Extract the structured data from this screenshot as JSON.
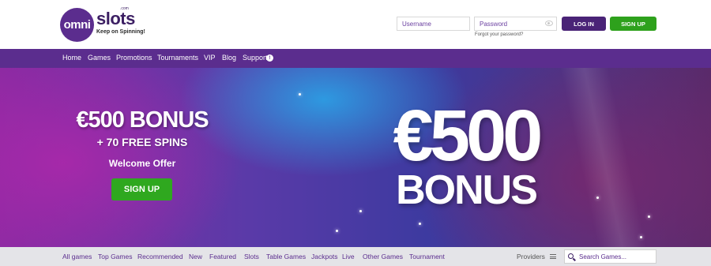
{
  "header": {
    "logo_left": "omni",
    "logo_right": "slots",
    "logo_com": ".com",
    "tagline": "Keep on Spinning!",
    "username_placeholder": "Username",
    "password_placeholder": "Password",
    "forgot": "Forgot your password?",
    "login_label": "LOG IN",
    "signup_label": "SIGN UP"
  },
  "nav": {
    "items": [
      "Home",
      "Games",
      "Promotions",
      "Tournaments",
      "VIP",
      "Blog",
      "Support"
    ],
    "support_badge": "!"
  },
  "hero": {
    "bonus_title": "€500 BONUS",
    "bonus_sub": "+ 70 FREE SPINS",
    "welcome": "Welcome Offer",
    "signup_label": "SIGN UP",
    "big_amount": "€500",
    "big_bonus": "BONUS"
  },
  "categories": {
    "items": [
      "All games",
      "Top Games",
      "Recommended",
      "New",
      "Featured",
      "Slots",
      "Table Games",
      "Jackpots",
      "Live",
      "Other Games",
      "Tournament"
    ],
    "providers_label": "Providers",
    "search_placeholder": "Search Games..."
  },
  "colors": {
    "brand_purple": "#5b2d8e",
    "signup_green": "#2ea11c",
    "login_purple": "#4a2377"
  }
}
